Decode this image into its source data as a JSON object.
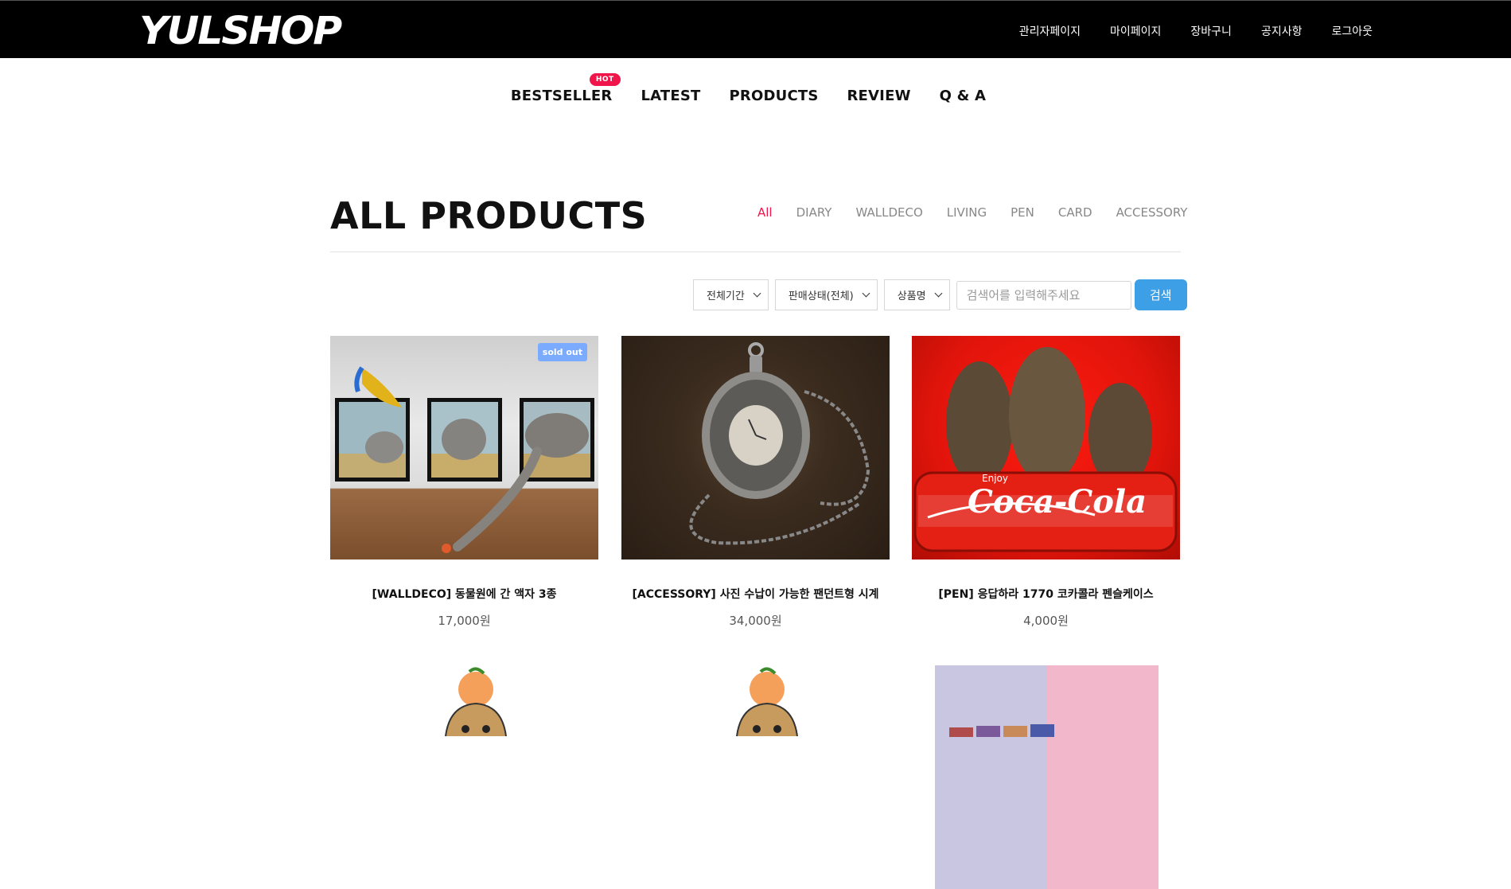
{
  "header": {
    "logo": "YULSHOP",
    "links": [
      "관리자페이지",
      "마이페이지",
      "장바구니",
      "공지사항",
      "로그아웃"
    ]
  },
  "mainnav": {
    "items": [
      "BESTSELLER",
      "LATEST",
      "PRODUCTS",
      "REVIEW",
      "Q & A"
    ],
    "hot_badge": "HOT"
  },
  "page": {
    "title": "ALL PRODUCTS",
    "categories": [
      "All",
      "DIARY",
      "WALLDECO",
      "LIVING",
      "PEN",
      "CARD",
      "ACCESSORY"
    ],
    "active_category": "All"
  },
  "filters": {
    "period": "전체기간",
    "status": "판매상태(전체)",
    "field": "상품명",
    "search_placeholder": "검색어를 입력해주세요",
    "search_button": "검색"
  },
  "products": [
    {
      "name": "[WALLDECO] 동물원에 간 액자 3종",
      "price": "17,000원",
      "badge": "sold out"
    },
    {
      "name": "[ACCESSORY] 사진 수납이 가능한 팬던트형 시계",
      "price": "34,000원"
    },
    {
      "name": "[PEN] 응답하라 1770 코카콜라 펜슬케이스",
      "price": "4,000원"
    }
  ],
  "colors": {
    "accent": "#f0154a",
    "search_button": "#3d9fe6",
    "soldout_badge": "#7aabff"
  }
}
